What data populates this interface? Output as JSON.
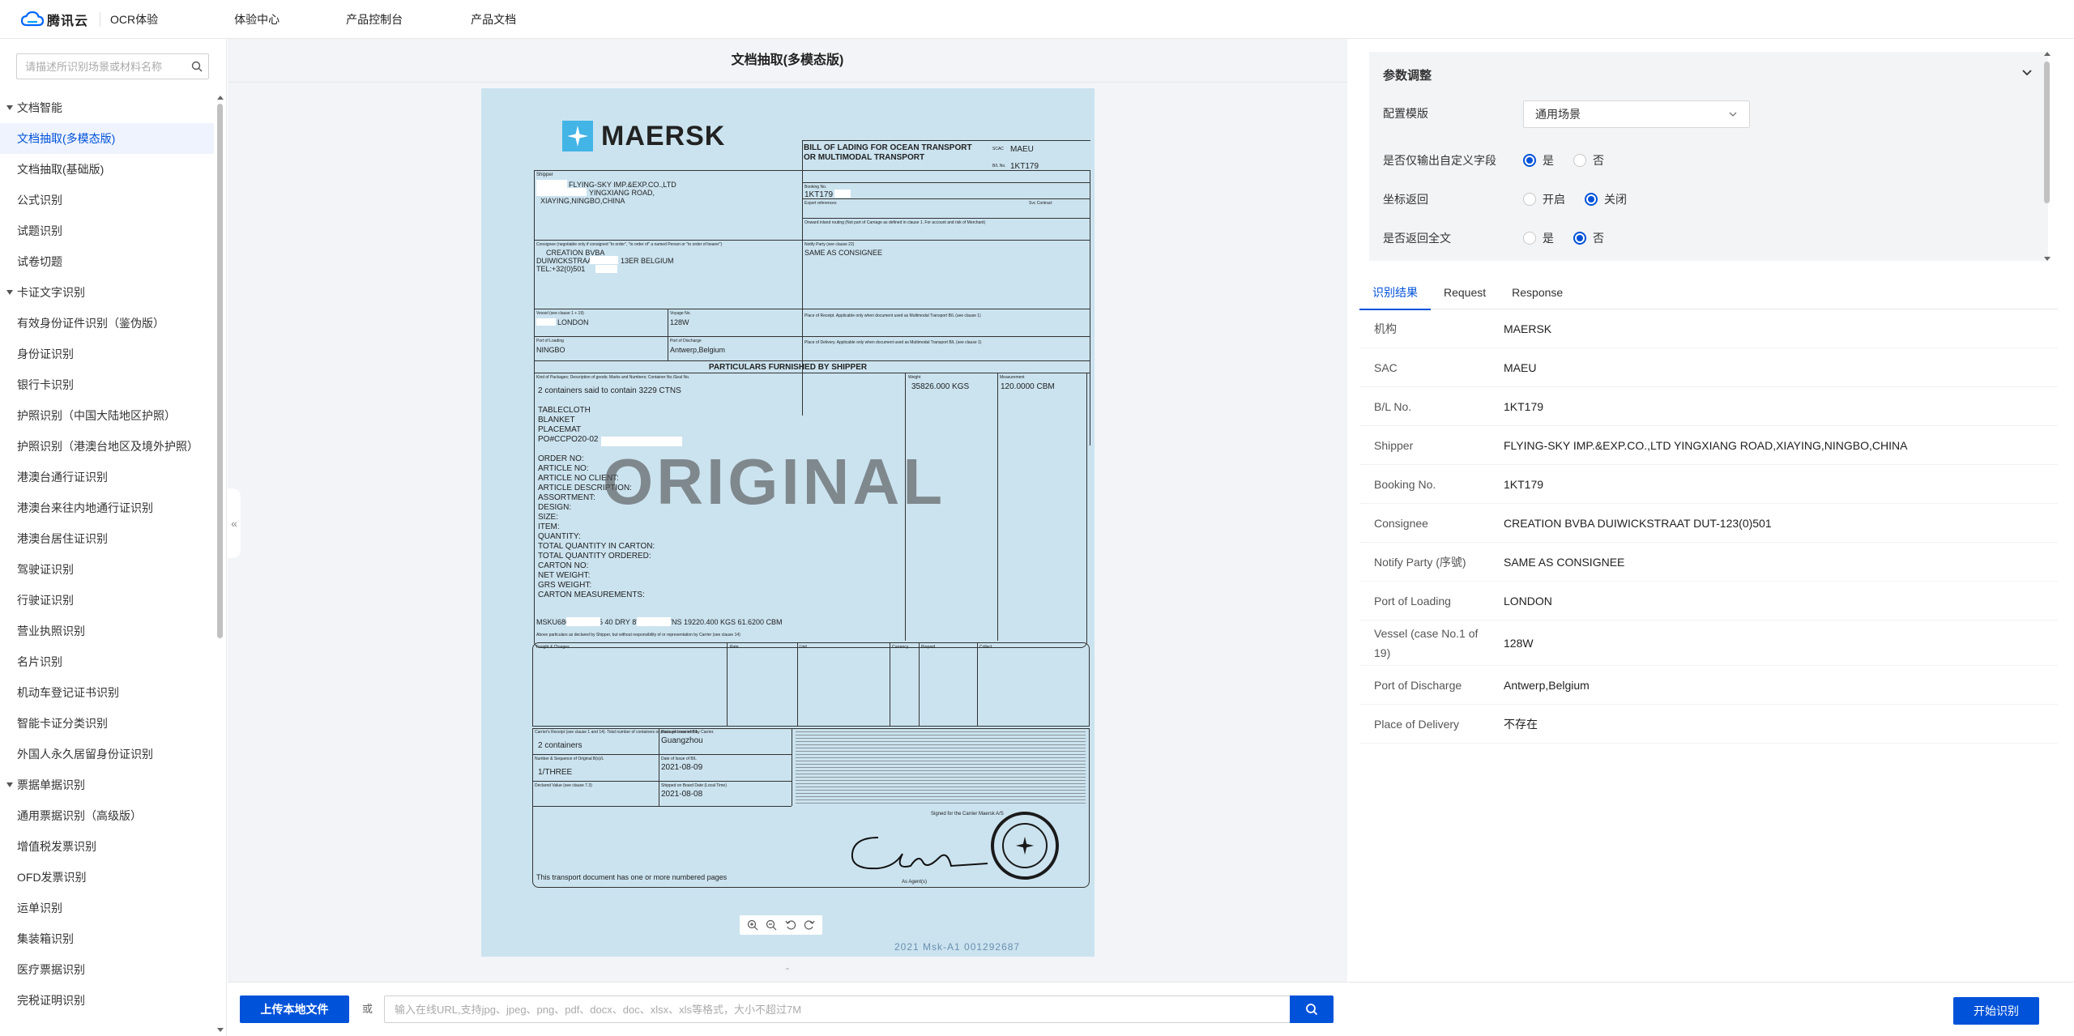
{
  "header": {
    "brand": "腾讯云",
    "product": "OCR体验",
    "nav": [
      "体验中心",
      "产品控制台",
      "产品文档"
    ]
  },
  "sidebar": {
    "search_placeholder": "请描述所识别场景或材料名称",
    "groups": [
      {
        "title": "文档智能",
        "items": [
          "文档抽取(多模态版)",
          "文档抽取(基础版)",
          "公式识别",
          "试题识别",
          "试卷切题"
        ]
      },
      {
        "title": "卡证文字识别",
        "items": [
          "有效身份证件识别（鉴伪版）",
          "身份证识别",
          "银行卡识别",
          "护照识别（中国大陆地区护照）",
          "护照识别（港澳台地区及境外护照）",
          "港澳台通行证识别",
          "港澳台来往内地通行证识别",
          "港澳台居住证识别",
          "驾驶证识别",
          "行驶证识别",
          "营业执照识别",
          "名片识别",
          "机动车登记证书识别",
          "智能卡证分类识别",
          "外国人永久居留身份证识别"
        ]
      },
      {
        "title": "票据单据识别",
        "items": [
          "通用票据识别（高级版）",
          "增值税发票识别",
          "OFD发票识别",
          "运单识别",
          "集装箱识别",
          "医疗票据识别",
          "完税证明识别"
        ]
      }
    ],
    "active_item": "文档抽取(多模态版)"
  },
  "center": {
    "title": "文档抽取(多模态版)",
    "upload_label": "上传本地文件",
    "or_label": "或",
    "url_placeholder": "输入在线URL,支持jpg、jpeg、png、pdf、docx、doc、xlsx、xls等格式，大小不超过7M"
  },
  "document": {
    "logo_text": "MAERSK",
    "title_line1": "BILL OF LADING FOR OCEAN TRANSPORT",
    "title_line2": "OR MULTIMODAL TRANSPORT",
    "scac_label": "SCAC",
    "scac_value": "MAEU",
    "bl_label": "B/L No.",
    "bl_value": "1KT179",
    "shipper_label": "Shipper",
    "shipper_lines": [
      "FLYING-SKY IMP.&EXP.CO.,LTD",
      "YINGXIANG ROAD,",
      "XIAYING,NINGBO,CHINA"
    ],
    "booking_label": "Booking No.",
    "booking_value": "1KT179",
    "export_ref_label": "Export references",
    "svc_label": "Svc Contract",
    "onward_label": "Onward inland routing (Not part of Carriage as defined in clause 1. For account and risk of Merchant)",
    "consignee_label": "Consignee (negotiable only if consigned \"to order\", \"to order of\" a named Person or \"to order of bearer\")",
    "consignee_lines": [
      "CREATION BVBA",
      "DUIWICKSTRAAT",
      "TEL:+32(0)501"
    ],
    "consignee_city": "13ER BELGIUM",
    "notify_label": "Notify Party (see clause 22)",
    "notify_value": "SAME AS CONSIGNEE",
    "vessel_label": "Vessel (see clause 1 + 19)",
    "vessel_value": "LONDON",
    "voyage_label": "Voyage No.",
    "voyage_value": "128W",
    "receipt_label": "Place of Receipt. Applicable only when document used as Multimodal Transport B/L (see clause 1)",
    "loading_label": "Port of Loading",
    "loading_value": "NINGBO",
    "discharge_label": "Port of Discharge",
    "discharge_value": "Antwerp,Belgium",
    "delivery_label": "Place of Delivery. Applicable only when document used as Multimodal Transport B/L (see clause 1)",
    "particulars_title": "PARTICULARS FURNISHED BY SHIPPER",
    "kind_label": "Kind of Packages; Description of goods; Marks and Numbers; Container No./Seal No.",
    "weight_label": "Weight",
    "measure_label": "Measurement",
    "weight_value": "35826.000 KGS",
    "measure_value": "120.0000 CBM",
    "goods_lines": [
      "2 containers said to contain 3229 CTNS",
      "",
      "TABLECLOTH",
      "BLANKET",
      "PLACEMAT",
      "PO#CCPO20-02",
      "",
      "ORDER NO:",
      "ARTICLE NO:",
      "ARTICLE NO CLIENT:",
      "ARTICLE DESCRIPTION:",
      "ASSORTMENT:",
      "DESIGN:",
      "SIZE:",
      "ITEM:",
      "QUANTITY:",
      "TOTAL QUANTITY IN CARTON:",
      "TOTAL QUANTITY ORDERED:",
      "CARTON NO:",
      "NET WEIGHT:",
      "GRS WEIGHT:",
      "CARTON MEASUREMENTS:"
    ],
    "container_line": "MSKU686          ML-CN95          40 DRY 8'6  1686 CTNS  19220.400 KGS  61.6200 CBM",
    "above_particulars": "Above particulars as declared by Shipper, but without responsibility of or representation by Carrier (see clause 14)",
    "watermark": "ORIGINAL",
    "freight_label": "Freight & Charges",
    "rate_label": "Rate",
    "unit_label": "Unit",
    "currency_label": "Currency",
    "prepaid_label": "Prepaid",
    "collect_label": "Collect",
    "carrier_receipt_label": "Carrier's Receipt (see clause 1 and 14). Total number of containers or packages received by Carrier.",
    "carrier_receipt_value": "2 containers",
    "place_issue_label": "Place of Issue of B/L",
    "place_issue_value": "Guangzhou",
    "number_label": "Number & Sequence of Original B(s)/L",
    "number_value": "1/THREE",
    "date_issue_label": "Date of Issue of B/L",
    "date_issue_value": "2021-08-09",
    "declared_label": "Declared Value (see clause 7.3)",
    "shipped_label": "Shipped on Board Date (Local Time)",
    "shipped_value": "2021-08-08",
    "signed_label": "Signed for the Carrier Maersk A/S",
    "agent_label": "As Agent(s)",
    "transport_note": "This transport document has one or more numbered pages",
    "footer_code": "2021 Msk-A1    001292687"
  },
  "params": {
    "title": "参数调整",
    "template_label": "配置模版",
    "template_value": "通用场景",
    "custom_only_label": "是否仅输出自定义字段",
    "coord_label": "坐标返回",
    "fulltext_label": "是否返回全文",
    "yes": "是",
    "no": "否",
    "on": "开启",
    "off": "关闭"
  },
  "tabs": [
    "识别结果",
    "Request",
    "Response"
  ],
  "results": [
    {
      "key": "机构",
      "value": "MAERSK"
    },
    {
      "key": "SAC",
      "value": "MAEU"
    },
    {
      "key": "B/L No.",
      "value": "1KT179"
    },
    {
      "key": "Shipper",
      "value": "FLYING-SKY IMP.&EXP.CO.,LTD YINGXIANG ROAD,XIAYING,NINGBO,CHINA"
    },
    {
      "key": "Booking No.",
      "value": "1KT179"
    },
    {
      "key": "Consignee",
      "value": "CREATION BVBA DUIWICKSTRAAT DUT-123(0)501"
    },
    {
      "key": "Notify Party (序號)",
      "value": "SAME AS CONSIGNEE"
    },
    {
      "key": "Port of Loading",
      "value": "LONDON"
    },
    {
      "key": "Vessel (case No.1 of 19)",
      "value": "128W"
    },
    {
      "key": "Port of Discharge",
      "value": "Antwerp,Belgium"
    },
    {
      "key": "Place of Delivery",
      "value": "不存在"
    }
  ],
  "start_label": "开始识别",
  "colors": {
    "primary": "#0052d9",
    "doc_bg": "#cbe3ef",
    "page_bg": "#f2f4f7"
  }
}
